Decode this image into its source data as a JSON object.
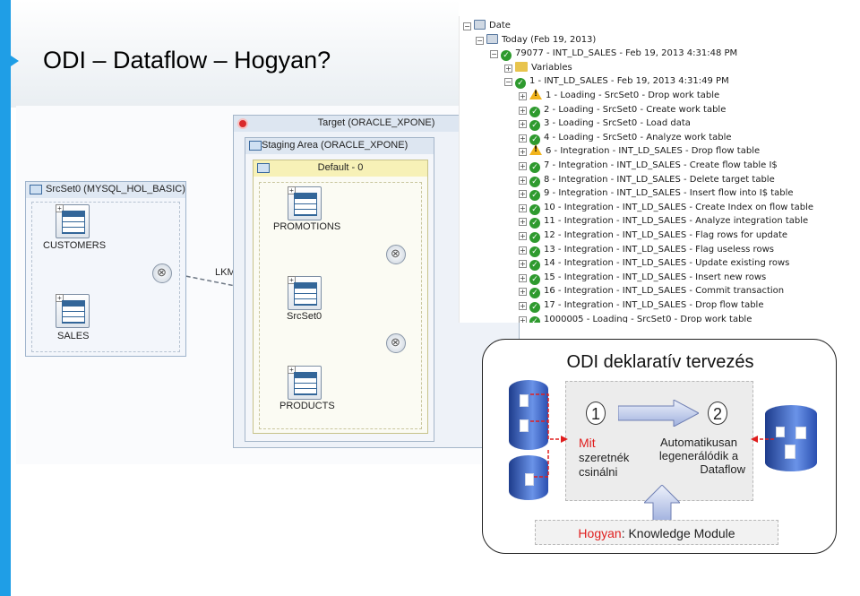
{
  "slide": {
    "title": "ODI – Dataflow – Hogyan?",
    "accent_color": "#1f9ee6"
  },
  "designer": {
    "source_set_label": "SrcSet0 (MYSQL_HOL_BASIC)",
    "source_tables": [
      "CUSTOMERS",
      "SALES"
    ],
    "target_label": "Target (ORACLE_XPONE)",
    "staging_label": "Staging Area (ORACLE_XPONE)",
    "default_label": "Default - 0",
    "staging_tables": [
      "PROMOTIONS",
      "SrcSet0",
      "PRODUCTS"
    ],
    "lkm_label": "LKM SQL to Oracle"
  },
  "tree": {
    "rows": [
      {
        "toggle": "⊟",
        "icon": "date",
        "text": "Date"
      },
      {
        "toggle": "⊟",
        "icon": "date",
        "text": "Today (Feb 19, 2013)"
      },
      {
        "toggle": "⊟",
        "icon": "ok",
        "text": "79077 - INT_LD_SALES - Feb 19, 2013 4:31:48 PM"
      },
      {
        "toggle": "⊞",
        "icon": "fold",
        "text": "Variables"
      },
      {
        "toggle": "⊟",
        "icon": "ok",
        "text": "1 - INT_LD_SALES - Feb 19, 2013 4:31:49 PM"
      },
      {
        "toggle": "⊞",
        "icon": "warn",
        "text": "1 - Loading - SrcSet0 - Drop work table"
      },
      {
        "toggle": "⊞",
        "icon": "ok",
        "text": "2 - Loading - SrcSet0 - Create work table"
      },
      {
        "toggle": "⊞",
        "icon": "ok",
        "text": "3 - Loading - SrcSet0 - Load data"
      },
      {
        "toggle": "⊞",
        "icon": "ok",
        "text": "4 - Loading - SrcSet0 - Analyze work table"
      },
      {
        "toggle": "⊞",
        "icon": "warn",
        "text": "6 - Integration - INT_LD_SALES - Drop flow table"
      },
      {
        "toggle": "⊞",
        "icon": "ok",
        "text": "7 - Integration - INT_LD_SALES - Create flow table I$"
      },
      {
        "toggle": "⊞",
        "icon": "ok",
        "text": "8 - Integration - INT_LD_SALES - Delete target table"
      },
      {
        "toggle": "⊞",
        "icon": "ok",
        "text": "9 - Integration - INT_LD_SALES - Insert flow into I$ table"
      },
      {
        "toggle": "⊞",
        "icon": "ok",
        "text": "10 - Integration - INT_LD_SALES - Create Index on flow table"
      },
      {
        "toggle": "⊞",
        "icon": "ok",
        "text": "11 - Integration - INT_LD_SALES - Analyze integration table"
      },
      {
        "toggle": "⊞",
        "icon": "ok",
        "text": "12 - Integration - INT_LD_SALES - Flag rows for update"
      },
      {
        "toggle": "⊞",
        "icon": "ok",
        "text": "13 - Integration - INT_LD_SALES - Flag useless rows"
      },
      {
        "toggle": "⊞",
        "icon": "ok",
        "text": "14 - Integration - INT_LD_SALES - Update existing rows"
      },
      {
        "toggle": "⊞",
        "icon": "ok",
        "text": "15 - Integration - INT_LD_SALES - Insert new rows"
      },
      {
        "toggle": "⊞",
        "icon": "ok",
        "text": "16 - Integration - INT_LD_SALES - Commit transaction"
      },
      {
        "toggle": "⊞",
        "icon": "ok",
        "text": "17 - Integration - INT_LD_SALES - Drop flow table"
      },
      {
        "toggle": "⊞",
        "icon": "ok",
        "text": "1000005 - Loading - SrcSet0 - Drop work table"
      }
    ]
  },
  "concept": {
    "title": "ODI deklaratív tervezés",
    "step1": "1",
    "step2": "2",
    "mit": "Mit",
    "mit_rest_line1": "szeretnék",
    "mit_rest_line2": "csinálni",
    "auto_line1": "Automatikusan",
    "auto_line2": "legenerálódik a",
    "auto_line3": "Dataflow",
    "hogyan_red": "Hogyan",
    "hogyan_rest": ": Knowledge Module",
    "red_color": "#e01e1e"
  }
}
